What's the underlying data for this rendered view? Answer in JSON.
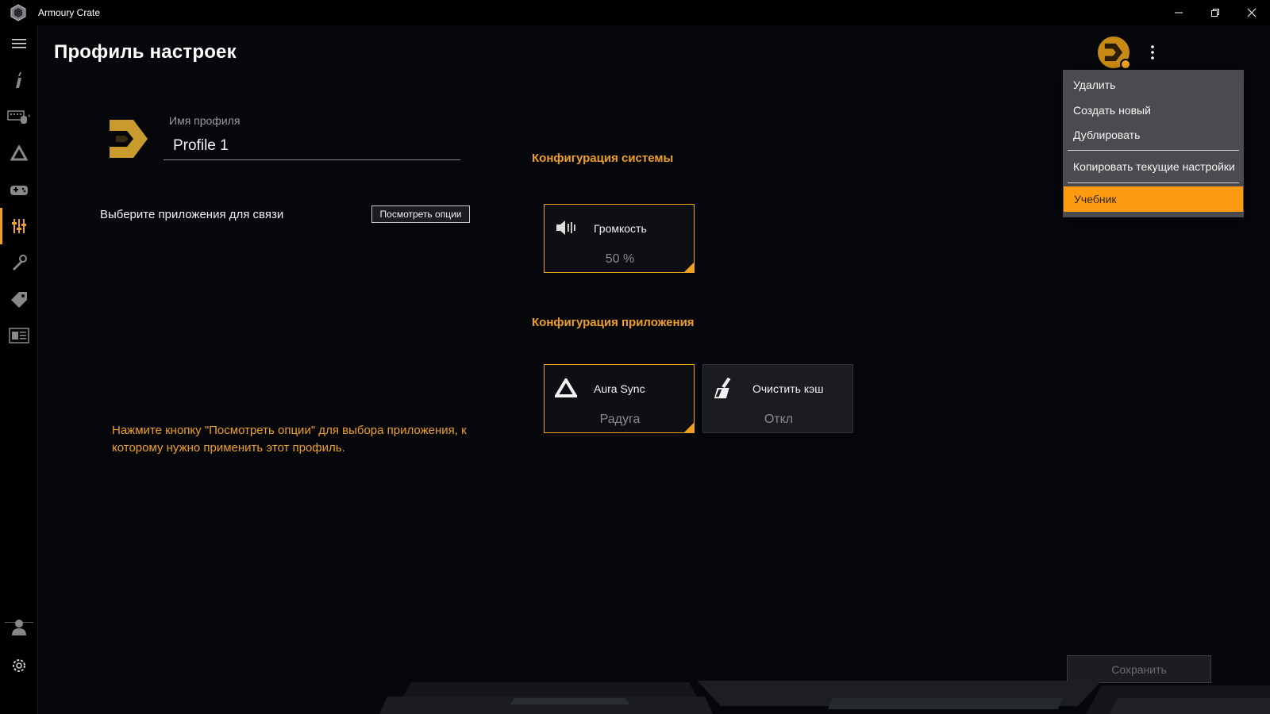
{
  "window": {
    "title": "Armoury Crate",
    "minimize_icon": "minimize-icon",
    "restore_icon": "restore-icon",
    "close_icon": "close-icon"
  },
  "sidebar": {
    "items": [
      {
        "icon": "hamburger-menu-icon"
      },
      {
        "icon": "info-icon"
      },
      {
        "icon": "devices-icon"
      },
      {
        "icon": "aura-sync-icon"
      },
      {
        "icon": "gamevisual-icon"
      },
      {
        "icon": "scenario-profiles-icon",
        "active": true
      },
      {
        "icon": "tools-icon"
      },
      {
        "icon": "deals-tag-icon"
      },
      {
        "icon": "news-icon"
      },
      {
        "icon": "user-icon"
      },
      {
        "icon": "settings-gear-icon"
      }
    ]
  },
  "header": {
    "title": "Профиль настроек"
  },
  "profile": {
    "name_label": "Имя профиля",
    "name_value": "Profile 1"
  },
  "link_apps": {
    "label": "Выберите приложения для связи",
    "button": "Посмотреть опции"
  },
  "hint": "Нажмите кнопку \"Посмотреть опции\" для выбора приложения, к которому нужно применить этот профиль.",
  "system_config": {
    "title": "Конфигурация системы",
    "tiles": [
      {
        "label": "Громкость",
        "value": "50 %",
        "icon": "volume-icon"
      }
    ]
  },
  "app_config": {
    "title": "Конфигурация приложения",
    "tiles": [
      {
        "label": "Aura Sync",
        "value": "Радуга",
        "icon": "aura-sync-icon"
      },
      {
        "label": "Очистить кэш",
        "value": "Откл",
        "icon": "clear-cache-icon"
      }
    ]
  },
  "menu": {
    "items": [
      "Удалить",
      "Создать новый",
      "Дублировать",
      "Копировать текущие настройки",
      "Учебник"
    ],
    "highlighted": "Учебник"
  },
  "save_button": "Сохранить",
  "colors": {
    "accent": "#f0a020",
    "menu_highlight": "#ff9b10",
    "menu_bg": "#4a4b4e",
    "background": "#05070b"
  }
}
